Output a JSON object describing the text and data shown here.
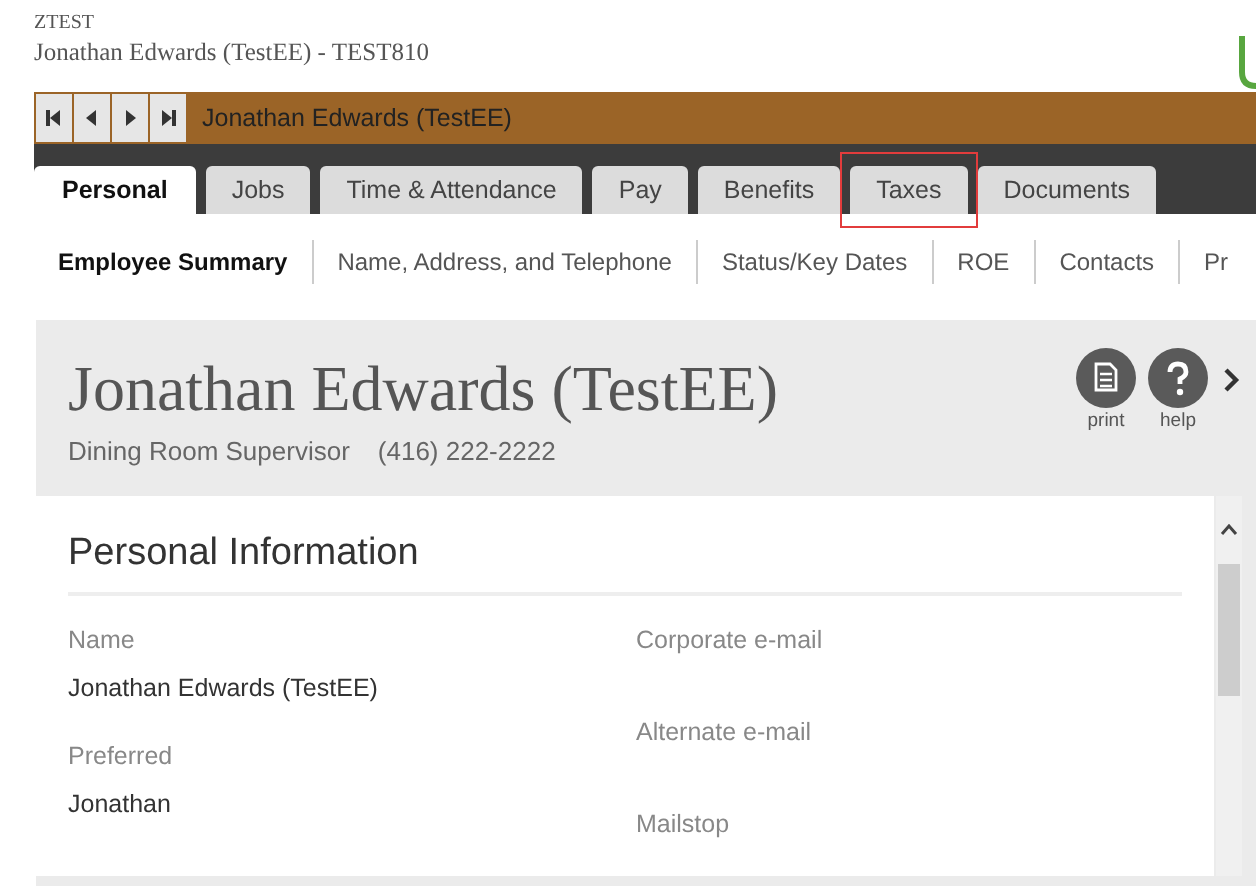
{
  "header": {
    "company": "ZTEST",
    "title": "Jonathan Edwards (TestEE) - TEST810"
  },
  "record_bar": {
    "name": "Jonathan Edwards (TestEE)"
  },
  "tabs": [
    {
      "label": "Personal",
      "selected": true,
      "highlighted": false
    },
    {
      "label": "Jobs",
      "selected": false,
      "highlighted": false
    },
    {
      "label": "Time & Attendance",
      "selected": false,
      "highlighted": false
    },
    {
      "label": "Pay",
      "selected": false,
      "highlighted": false
    },
    {
      "label": "Benefits",
      "selected": false,
      "highlighted": false
    },
    {
      "label": "Taxes",
      "selected": false,
      "highlighted": true
    },
    {
      "label": "Documents",
      "selected": false,
      "highlighted": false
    }
  ],
  "sub_tabs": [
    {
      "label": "Employee Summary",
      "selected": true
    },
    {
      "label": "Name, Address, and Telephone",
      "selected": false
    },
    {
      "label": "Status/Key Dates",
      "selected": false
    },
    {
      "label": "ROE",
      "selected": false
    },
    {
      "label": "Contacts",
      "selected": false
    },
    {
      "label": "Pr",
      "selected": false
    }
  ],
  "profile": {
    "name": "Jonathan Edwards (TestEE)",
    "position": "Dining Room Supervisor",
    "phone": "(416) 222-2222",
    "actions": [
      {
        "kind": "print",
        "label": "print"
      },
      {
        "kind": "help",
        "label": "help"
      }
    ]
  },
  "section": {
    "title": "Personal Information",
    "left_fields": [
      {
        "label": "Name",
        "value": "Jonathan Edwards (TestEE)"
      },
      {
        "label": "Preferred",
        "value": "Jonathan"
      }
    ],
    "right_fields": [
      {
        "label": "Corporate e-mail"
      },
      {
        "label": "Alternate e-mail"
      },
      {
        "label": "Mailstop"
      }
    ]
  }
}
